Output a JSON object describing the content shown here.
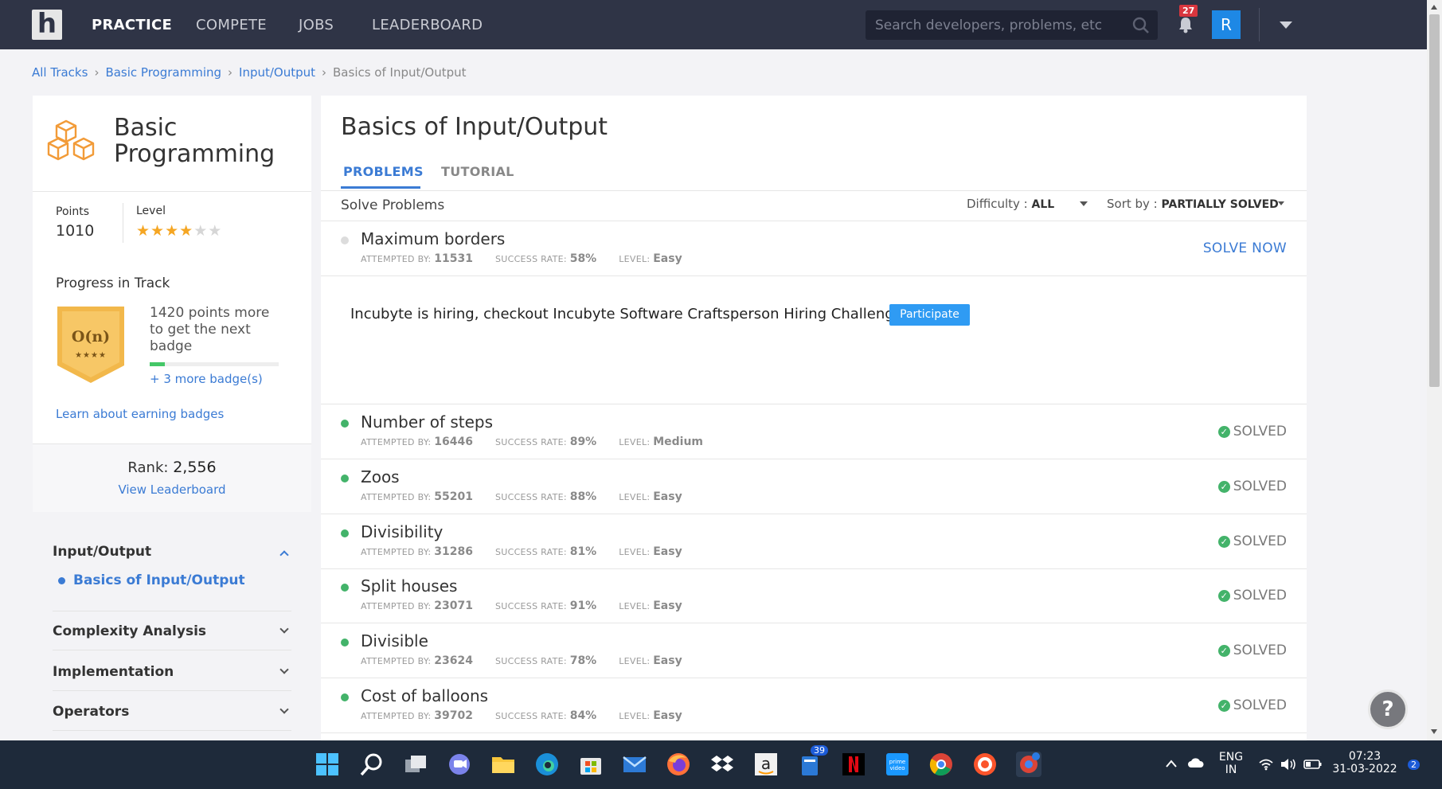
{
  "nav": {
    "logo": "h",
    "links": [
      "PRACTICE",
      "COMPETE",
      "JOBS",
      "LEADERBOARD"
    ],
    "search_placeholder": "Search developers, problems, etc",
    "notification_count": "27",
    "avatar_initial": "R"
  },
  "breadcrumb": [
    "All Tracks",
    "Basic Programming",
    "Input/Output",
    "Basics of Input/Output"
  ],
  "track": {
    "title": "Basic Programming",
    "points_label": "Points",
    "points_value": "1010",
    "level_label": "Level",
    "level_stars": 4,
    "level_max": 6,
    "progress_title": "Progress in Track",
    "badge_symbol": "O(n)",
    "badge_stars": "★★★★",
    "badge_text": "1420 points more to get the next badge",
    "badge_progress": 0.12,
    "more_badges": "+ 3 more badge(s)",
    "learn_link": "Learn about earning badges",
    "rank_label": "Rank:",
    "rank_value": "2,556",
    "leaderboard_link": "View Leaderboard"
  },
  "topics": {
    "open": "Input/Output",
    "active_sub": "Basics of Input/Output",
    "others": [
      "Complexity Analysis",
      "Implementation",
      "Operators"
    ]
  },
  "main": {
    "title": "Basics of Input/Output",
    "tabs": [
      "PROBLEMS",
      "TUTORIAL"
    ],
    "solve_label": "Solve Problems",
    "difficulty_label": "Difficulty :",
    "difficulty_value": "ALL",
    "sort_label": "Sort by :",
    "sort_value": "PARTIALLY SOLVED",
    "meta_labels": {
      "attempted": "ATTEMPTED BY:",
      "success": "SUCCESS RATE:",
      "level": "LEVEL:"
    },
    "promo_text": "Incubyte is hiring, checkout Incubyte Software Craftsperson Hiring Challenge",
    "promo_button": "Participate",
    "solve_now": "SOLVE NOW",
    "solved_label": "SOLVED",
    "problems": [
      {
        "name": "Maximum borders",
        "attempted": "11531",
        "success": "58%",
        "level": "Easy",
        "status": "unsolved"
      },
      {
        "name": "Number of steps",
        "attempted": "16446",
        "success": "89%",
        "level": "Medium",
        "status": "solved"
      },
      {
        "name": "Zoos",
        "attempted": "55201",
        "success": "88%",
        "level": "Easy",
        "status": "solved"
      },
      {
        "name": "Divisibility",
        "attempted": "31286",
        "success": "81%",
        "level": "Easy",
        "status": "solved"
      },
      {
        "name": "Split houses",
        "attempted": "23071",
        "success": "91%",
        "level": "Easy",
        "status": "solved"
      },
      {
        "name": "Divisible",
        "attempted": "23624",
        "success": "78%",
        "level": "Easy",
        "status": "solved"
      },
      {
        "name": "Cost of balloons",
        "attempted": "39702",
        "success": "84%",
        "level": "Easy",
        "status": "solved"
      }
    ]
  },
  "taskbar": {
    "lang_line1": "ENG",
    "lang_line2": "IN",
    "time": "07:23",
    "date": "31-03-2022",
    "store_badge": "39",
    "notif_badge": "2",
    "icons": [
      "windows-start",
      "search",
      "task-view",
      "teams-chat",
      "file-explorer",
      "edge",
      "store",
      "mail",
      "firefox",
      "dropbox",
      "amazon",
      "whatsapp-store",
      "netflix",
      "prime-video",
      "chrome",
      "brave",
      "chrome-profile"
    ]
  },
  "colors": {
    "nav_bg": "#2f3446",
    "accent": "#3b7bd4",
    "solved_green": "#43b36a",
    "star": "#f5a623",
    "badge_orange": "#f2b84b"
  }
}
